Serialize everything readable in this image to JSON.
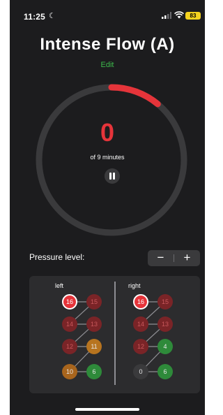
{
  "status_bar": {
    "time": "11:25",
    "battery": "83"
  },
  "header": {
    "title": "Intense Flow (A)",
    "edit_label": "Edit"
  },
  "timer": {
    "value": "0",
    "caption": "of 9 minutes",
    "progress_fraction": 0.11
  },
  "pressure": {
    "label": "Pressure level:",
    "minus_label": "−",
    "plus_label": "+"
  },
  "zones": {
    "left_label": "left",
    "right_label": "right",
    "left": [
      {
        "value": "16",
        "active": true,
        "color": "#e5343a"
      },
      {
        "value": "15",
        "active": false,
        "color": "#7a2427"
      },
      {
        "value": "14",
        "active": false,
        "color": "#7a2427"
      },
      {
        "value": "13",
        "active": false,
        "color": "#7a2427"
      },
      {
        "value": "12",
        "active": false,
        "color": "#7a2427"
      },
      {
        "value": "11",
        "active": false,
        "color": "#b7741f"
      },
      {
        "value": "10",
        "active": false,
        "color": "#a8651d"
      },
      {
        "value": "6",
        "active": false,
        "color": "#2e8a3a"
      }
    ],
    "right": [
      {
        "value": "16",
        "active": true,
        "color": "#e5343a"
      },
      {
        "value": "15",
        "active": false,
        "color": "#7a2427"
      },
      {
        "value": "14",
        "active": false,
        "color": "#7a2427"
      },
      {
        "value": "13",
        "active": false,
        "color": "#7a2427"
      },
      {
        "value": "12",
        "active": false,
        "color": "#7a2427"
      },
      {
        "value": "4",
        "active": false,
        "color": "#2e8a3a"
      },
      {
        "value": "0",
        "active": false,
        "color": "#3a3a3c"
      },
      {
        "value": "6",
        "active": false,
        "color": "#2e8a3a"
      }
    ]
  },
  "colors": {
    "accent_red": "#e5343a",
    "edit_green": "#3dbb4c",
    "background": "#1c1c1e"
  }
}
